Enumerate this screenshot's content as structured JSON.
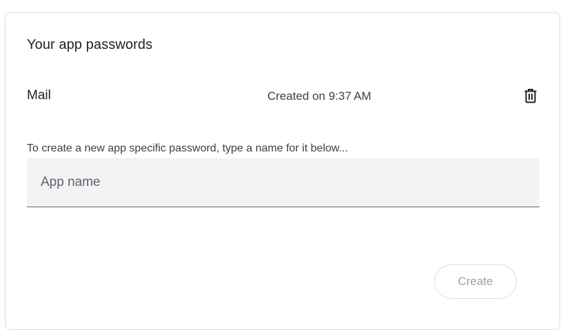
{
  "section": {
    "title": "Your app passwords"
  },
  "passwords": [
    {
      "name": "Mail",
      "created": "Created on 9:37 AM",
      "delete_icon": "trash-icon"
    }
  ],
  "create_form": {
    "helper_text": "To create a new app specific password, type a name for it below...",
    "input_placeholder": "App name",
    "input_value": "",
    "create_label": "Create",
    "create_enabled": false
  },
  "colors": {
    "card_border": "#dadce0",
    "field_background": "#f1f3f4",
    "field_underline": "#5f6368",
    "text_primary": "#202124",
    "text_secondary": "#3c4043",
    "button_disabled_text": "#9aa0a6"
  }
}
